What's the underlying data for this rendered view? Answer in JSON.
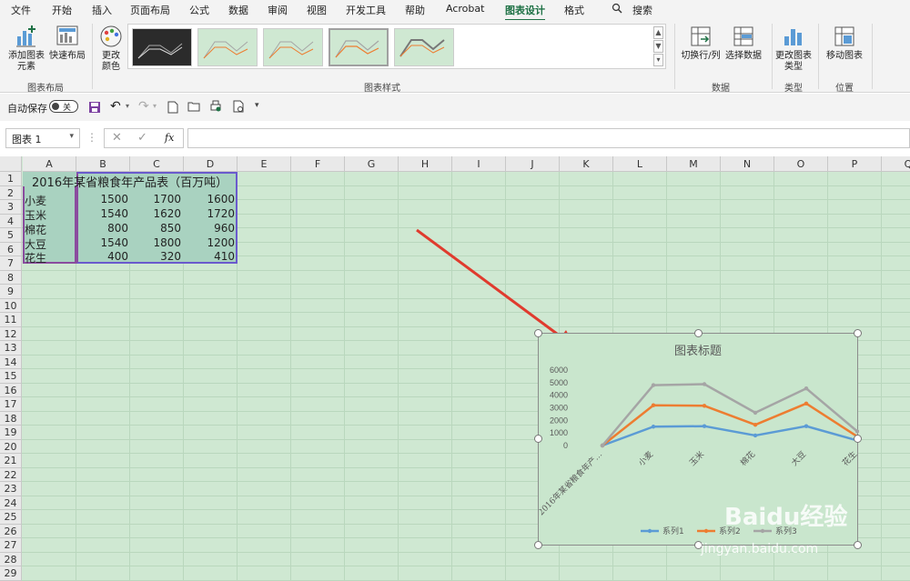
{
  "menu": {
    "tabs": [
      "文件",
      "开始",
      "插入",
      "页面布局",
      "公式",
      "数据",
      "审阅",
      "视图",
      "开发工具",
      "帮助",
      "Acrobat",
      "图表设计",
      "格式"
    ],
    "active_tab": "图表设计",
    "search_label": "搜索"
  },
  "ribbon": {
    "add_chart_element": "添加图表元素",
    "quick_layout": "快速布局",
    "group_chart_layout": "图表布局",
    "change_colors": "更改颜色",
    "group_chart_styles": "图表样式",
    "switch_row_col": "切换行/列",
    "select_data": "选择数据",
    "group_data": "数据",
    "change_chart_type": "更改图表类型",
    "group_type": "类型",
    "move_chart": "移动图表",
    "group_location": "位置"
  },
  "qat": {
    "autosave_label": "自动保存",
    "autosave_state": "关"
  },
  "formula_bar": {
    "name_box": "图表 1",
    "fx": "fx",
    "value": ""
  },
  "sheet": {
    "columns": [
      "A",
      "B",
      "C",
      "D",
      "E",
      "F",
      "G",
      "H",
      "I",
      "J",
      "K",
      "L",
      "M",
      "N",
      "O",
      "P",
      "Q"
    ],
    "rows": [
      "1",
      "2",
      "3",
      "4",
      "5",
      "6",
      "7",
      "8",
      "9",
      "10",
      "11",
      "12",
      "13",
      "14",
      "15",
      "16",
      "17",
      "18",
      "19",
      "20",
      "21",
      "22",
      "23",
      "24",
      "25",
      "26",
      "27",
      "28",
      "29"
    ],
    "title": "2016年某省粮食年产品表（百万吨）",
    "data": [
      {
        "name": "小麦",
        "b": "1500",
        "c": "1700",
        "d": "1600"
      },
      {
        "name": "玉米",
        "b": "1540",
        "c": "1620",
        "d": "1720"
      },
      {
        "name": "棉花",
        "b": "800",
        "c": "850",
        "d": "960"
      },
      {
        "name": "大豆",
        "b": "1540",
        "c": "1800",
        "d": "1200"
      },
      {
        "name": "花生",
        "b": "400",
        "c": "320",
        "d": "410"
      }
    ]
  },
  "chart_data": {
    "type": "line",
    "stacked": true,
    "title": "图表标题",
    "categories": [
      "2016年某省粮食年产…",
      "小麦",
      "玉米",
      "棉花",
      "大豆",
      "花生"
    ],
    "y_ticks": [
      "0",
      "1000",
      "2000",
      "3000",
      "4000",
      "5000",
      "6000"
    ],
    "ylim": [
      0,
      6000
    ],
    "series": [
      {
        "name": "系列1",
        "values": [
          0,
          1500,
          1540,
          800,
          1540,
          400
        ],
        "color": "#5b9bd5"
      },
      {
        "name": "系列2",
        "values": [
          0,
          1700,
          1620,
          850,
          1800,
          320
        ],
        "color": "#ed7d31"
      },
      {
        "name": "系列3",
        "values": [
          0,
          1600,
          1720,
          960,
          1200,
          410
        ],
        "color": "#a5a5a5"
      }
    ],
    "legend_position": "bottom"
  },
  "watermark": {
    "brand": "Baidu经验",
    "url": "jingyan.baidu.com"
  },
  "colors": {
    "accent": "#1e7145",
    "sheet_bg": "#cfe8d2",
    "arrow": "#e03b2e"
  }
}
